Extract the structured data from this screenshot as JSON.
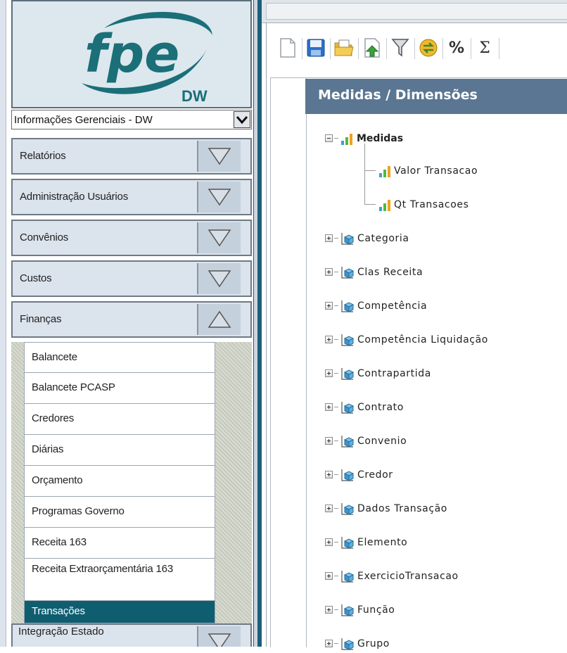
{
  "logo": {
    "brand": "fpe",
    "sub": "DW"
  },
  "module_select": {
    "value": "Informações Gerenciais - DW"
  },
  "menu": [
    {
      "label": "Relatórios",
      "expanded": false
    },
    {
      "label": "Administração Usuários",
      "expanded": false
    },
    {
      "label": "Convênios",
      "expanded": false
    },
    {
      "label": "Custos",
      "expanded": false
    },
    {
      "label": "Finanças",
      "expanded": true
    }
  ],
  "submenu": [
    {
      "label": "Balancete"
    },
    {
      "label": "Balancete PCASP"
    },
    {
      "label": "Credores"
    },
    {
      "label": "Diárias"
    },
    {
      "label": "Orçamento"
    },
    {
      "label": "Programas Governo"
    },
    {
      "label": "Receita 163"
    },
    {
      "label": "Receita Extraorçamentária 163"
    },
    {
      "label": "Transações",
      "active": true
    }
  ],
  "last_menu": {
    "label": "Integração Estado"
  },
  "toolbar": [
    {
      "icon": "new-document-icon"
    },
    {
      "icon": "save-icon"
    },
    {
      "icon": "open-folder-icon"
    },
    {
      "icon": "export-icon"
    },
    {
      "icon": "filter-icon"
    },
    {
      "icon": "swap-icon"
    },
    {
      "icon": "percent-icon",
      "glyph": "%"
    },
    {
      "icon": "sum-icon",
      "glyph": "Σ"
    }
  ],
  "panel": {
    "title": "Medidas / Dimensões",
    "measures_label": "Medidas",
    "measures": [
      "Valor Transacao",
      "Qt Transacoes"
    ],
    "dimensions": [
      "Categoria",
      "Clas Receita",
      "Competência",
      "Competência Liquidação",
      "Contrapartida",
      "Contrato",
      "Convenio",
      "Credor",
      "Dados Transação",
      "Elemento",
      "ExercicioTransacao",
      "Função",
      "Grupo"
    ]
  },
  "colors": {
    "active_item": "#0e5e70",
    "panel_header": "#5a7692",
    "logo_teal": "#1a6f78"
  }
}
